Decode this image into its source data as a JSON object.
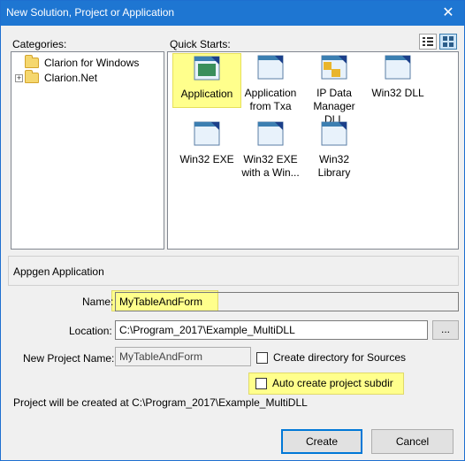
{
  "window": {
    "title": "New Solution, Project or Application",
    "close_glyph": "✕"
  },
  "categories": {
    "label": "Categories:",
    "items": [
      {
        "label": "Clarion for Windows",
        "expandable": false
      },
      {
        "label": "Clarion.Net",
        "expandable": true,
        "expander": "+"
      }
    ]
  },
  "quick_starts": {
    "label": "Quick Starts:",
    "tiles": [
      {
        "label": "Application",
        "icon": "application-icon",
        "selected": true
      },
      {
        "label": "Application from Txa",
        "icon": "application-icon"
      },
      {
        "label": "IP Data Manager DLL",
        "icon": "ip-data-manager-icon"
      },
      {
        "label": "Win32 DLL",
        "icon": "window-icon"
      },
      {
        "label": "Win32 EXE",
        "icon": "window-icon"
      },
      {
        "label": "Win32 EXE with a Win...",
        "icon": "window-icon"
      },
      {
        "label": "Win32 Library",
        "icon": "window-icon"
      }
    ]
  },
  "description": {
    "text": "Appgen Application"
  },
  "form": {
    "name_label": "Name:",
    "name_value": "MyTableAndForm",
    "location_label": "Location:",
    "location_value": "C:\\Program_2017\\Example_MultiDLL",
    "browse_label": "...",
    "project_name_label": "New Project Name:",
    "project_name_value": "MyTableAndForm",
    "create_dir_label": "Create directory for Sources",
    "auto_subdir_label": "Auto create project subdir",
    "status_text": "Project will be created at C:\\Program_2017\\Example_MultiDLL"
  },
  "buttons": {
    "create": "Create",
    "cancel": "Cancel"
  },
  "colors": {
    "titlebar": "#1e76d2",
    "highlight": "#ffff8c",
    "default_button_border": "#0078d7"
  }
}
